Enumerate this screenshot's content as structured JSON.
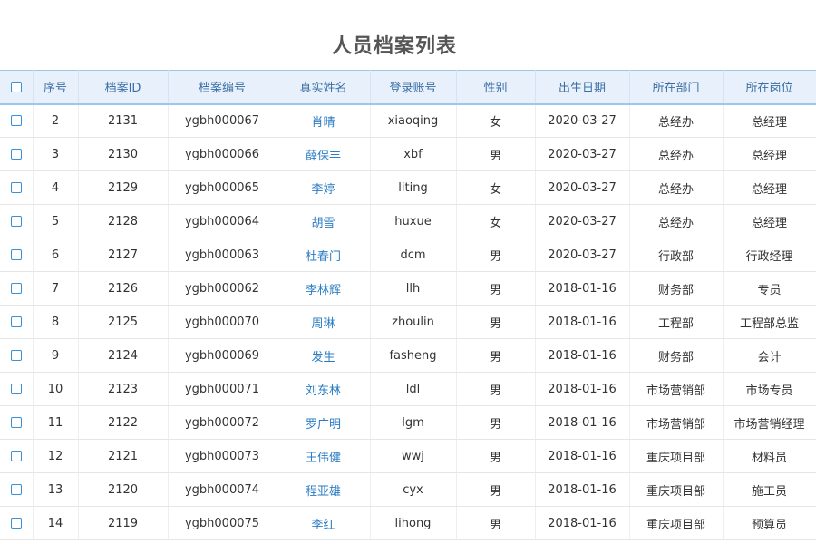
{
  "page": {
    "title": "人员档案列表"
  },
  "colors": {
    "header_bg": "#e8f1fb",
    "header_text": "#3a6ea5",
    "link": "#2b7cc4",
    "checkbox_border": "#3b8fd6"
  },
  "table": {
    "columns": [
      "",
      "序号",
      "档案ID",
      "档案编号",
      "真实姓名",
      "登录账号",
      "性别",
      "出生日期",
      "所在部门",
      "所在岗位"
    ],
    "rows": [
      {
        "seq": "2",
        "id": "2131",
        "code": "ygbh000067",
        "name": "肖晴",
        "account": "xiaoqing",
        "gender": "女",
        "birth": "2020-03-27",
        "dept": "总经办",
        "post": "总经理"
      },
      {
        "seq": "3",
        "id": "2130",
        "code": "ygbh000066",
        "name": "薛保丰",
        "account": "xbf",
        "gender": "男",
        "birth": "2020-03-27",
        "dept": "总经办",
        "post": "总经理"
      },
      {
        "seq": "4",
        "id": "2129",
        "code": "ygbh000065",
        "name": "李婷",
        "account": "liting",
        "gender": "女",
        "birth": "2020-03-27",
        "dept": "总经办",
        "post": "总经理"
      },
      {
        "seq": "5",
        "id": "2128",
        "code": "ygbh000064",
        "name": "胡雪",
        "account": "huxue",
        "gender": "女",
        "birth": "2020-03-27",
        "dept": "总经办",
        "post": "总经理"
      },
      {
        "seq": "6",
        "id": "2127",
        "code": "ygbh000063",
        "name": "杜春门",
        "account": "dcm",
        "gender": "男",
        "birth": "2020-03-27",
        "dept": "行政部",
        "post": "行政经理"
      },
      {
        "seq": "7",
        "id": "2126",
        "code": "ygbh000062",
        "name": "李林辉",
        "account": "llh",
        "gender": "男",
        "birth": "2018-01-16",
        "dept": "财务部",
        "post": "专员"
      },
      {
        "seq": "8",
        "id": "2125",
        "code": "ygbh000070",
        "name": "周琳",
        "account": "zhoulin",
        "gender": "男",
        "birth": "2018-01-16",
        "dept": "工程部",
        "post": "工程部总监"
      },
      {
        "seq": "9",
        "id": "2124",
        "code": "ygbh000069",
        "name": "发生",
        "account": "fasheng",
        "gender": "男",
        "birth": "2018-01-16",
        "dept": "财务部",
        "post": "会计"
      },
      {
        "seq": "10",
        "id": "2123",
        "code": "ygbh000071",
        "name": "刘东林",
        "account": "ldl",
        "gender": "男",
        "birth": "2018-01-16",
        "dept": "市场营销部",
        "post": "市场专员"
      },
      {
        "seq": "11",
        "id": "2122",
        "code": "ygbh000072",
        "name": "罗广明",
        "account": "lgm",
        "gender": "男",
        "birth": "2018-01-16",
        "dept": "市场营销部",
        "post": "市场营销经理"
      },
      {
        "seq": "12",
        "id": "2121",
        "code": "ygbh000073",
        "name": "王伟健",
        "account": "wwj",
        "gender": "男",
        "birth": "2018-01-16",
        "dept": "重庆项目部",
        "post": "材料员"
      },
      {
        "seq": "13",
        "id": "2120",
        "code": "ygbh000074",
        "name": "程亚雄",
        "account": "cyx",
        "gender": "男",
        "birth": "2018-01-16",
        "dept": "重庆项目部",
        "post": "施工员"
      },
      {
        "seq": "14",
        "id": "2119",
        "code": "ygbh000075",
        "name": "李红",
        "account": "lihong",
        "gender": "男",
        "birth": "2018-01-16",
        "dept": "重庆项目部",
        "post": "预算员"
      }
    ]
  }
}
